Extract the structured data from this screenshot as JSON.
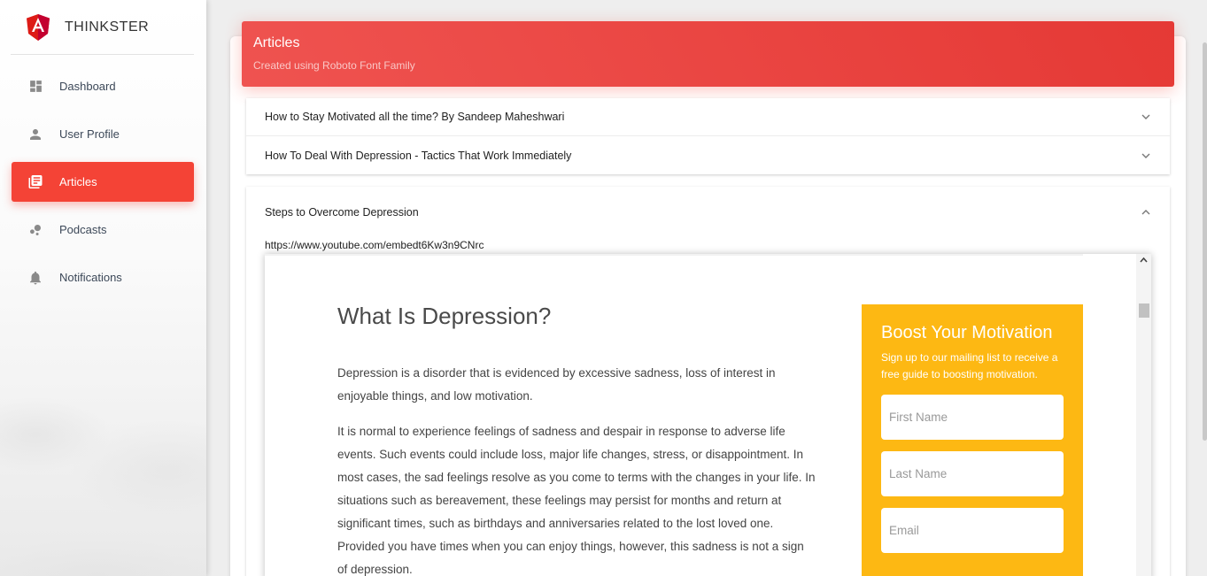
{
  "brand": {
    "name": "THINKSTER",
    "logo_icon": "angular-logo-icon",
    "logo_color": "#dd1b16"
  },
  "sidebar": {
    "items": [
      {
        "label": "Dashboard",
        "icon": "dashboard-icon",
        "active": false
      },
      {
        "label": "User Profile",
        "icon": "person-icon",
        "active": false
      },
      {
        "label": "Articles",
        "icon": "library-books-icon",
        "active": true
      },
      {
        "label": "Podcasts",
        "icon": "bubble-chart-icon",
        "active": false
      },
      {
        "label": "Notifications",
        "icon": "bell-icon",
        "active": false
      }
    ],
    "active_color": "#f44336"
  },
  "header": {
    "title": "Articles",
    "subtitle": "Created using Roboto Font Family"
  },
  "accordion": {
    "collapsed": [
      {
        "title": "How to Stay Motivated all the time? By Sandeep Maheshwari"
      },
      {
        "title": "How To Deal With Depression - Tactics That Work Immediately"
      }
    ],
    "expanded": {
      "title": "Steps to Overcome Depression",
      "url": "https://www.youtube.com/embedt6Kw3n9CNrc"
    }
  },
  "embed": {
    "heading": "What Is Depression?",
    "paragraphs": [
      "Depression is a disorder that is evidenced by excessive sadness, loss of interest in enjoyable things, and low motivation.",
      "It is normal to experience feelings of sadness and despair in response to adverse life events. Such events could include loss, major life changes, stress, or disappointment. In most cases, the sad feelings resolve as you come to terms with the changes in your life. In situations such as bereavement, these feelings may persist for months and return at significant times, such as birthdays and anniversaries related to the lost loved one. Provided you have times when you can enjoy things, however, this sadness is not a sign of depression."
    ],
    "optin": {
      "title": "Boost Your Motivation",
      "subtitle": "Sign up to our mailing list to receive a free guide to boosting motivation.",
      "first_name_placeholder": "First Name",
      "last_name_placeholder": "Last Name",
      "email_placeholder": "Email",
      "color": "#fdb813"
    }
  }
}
